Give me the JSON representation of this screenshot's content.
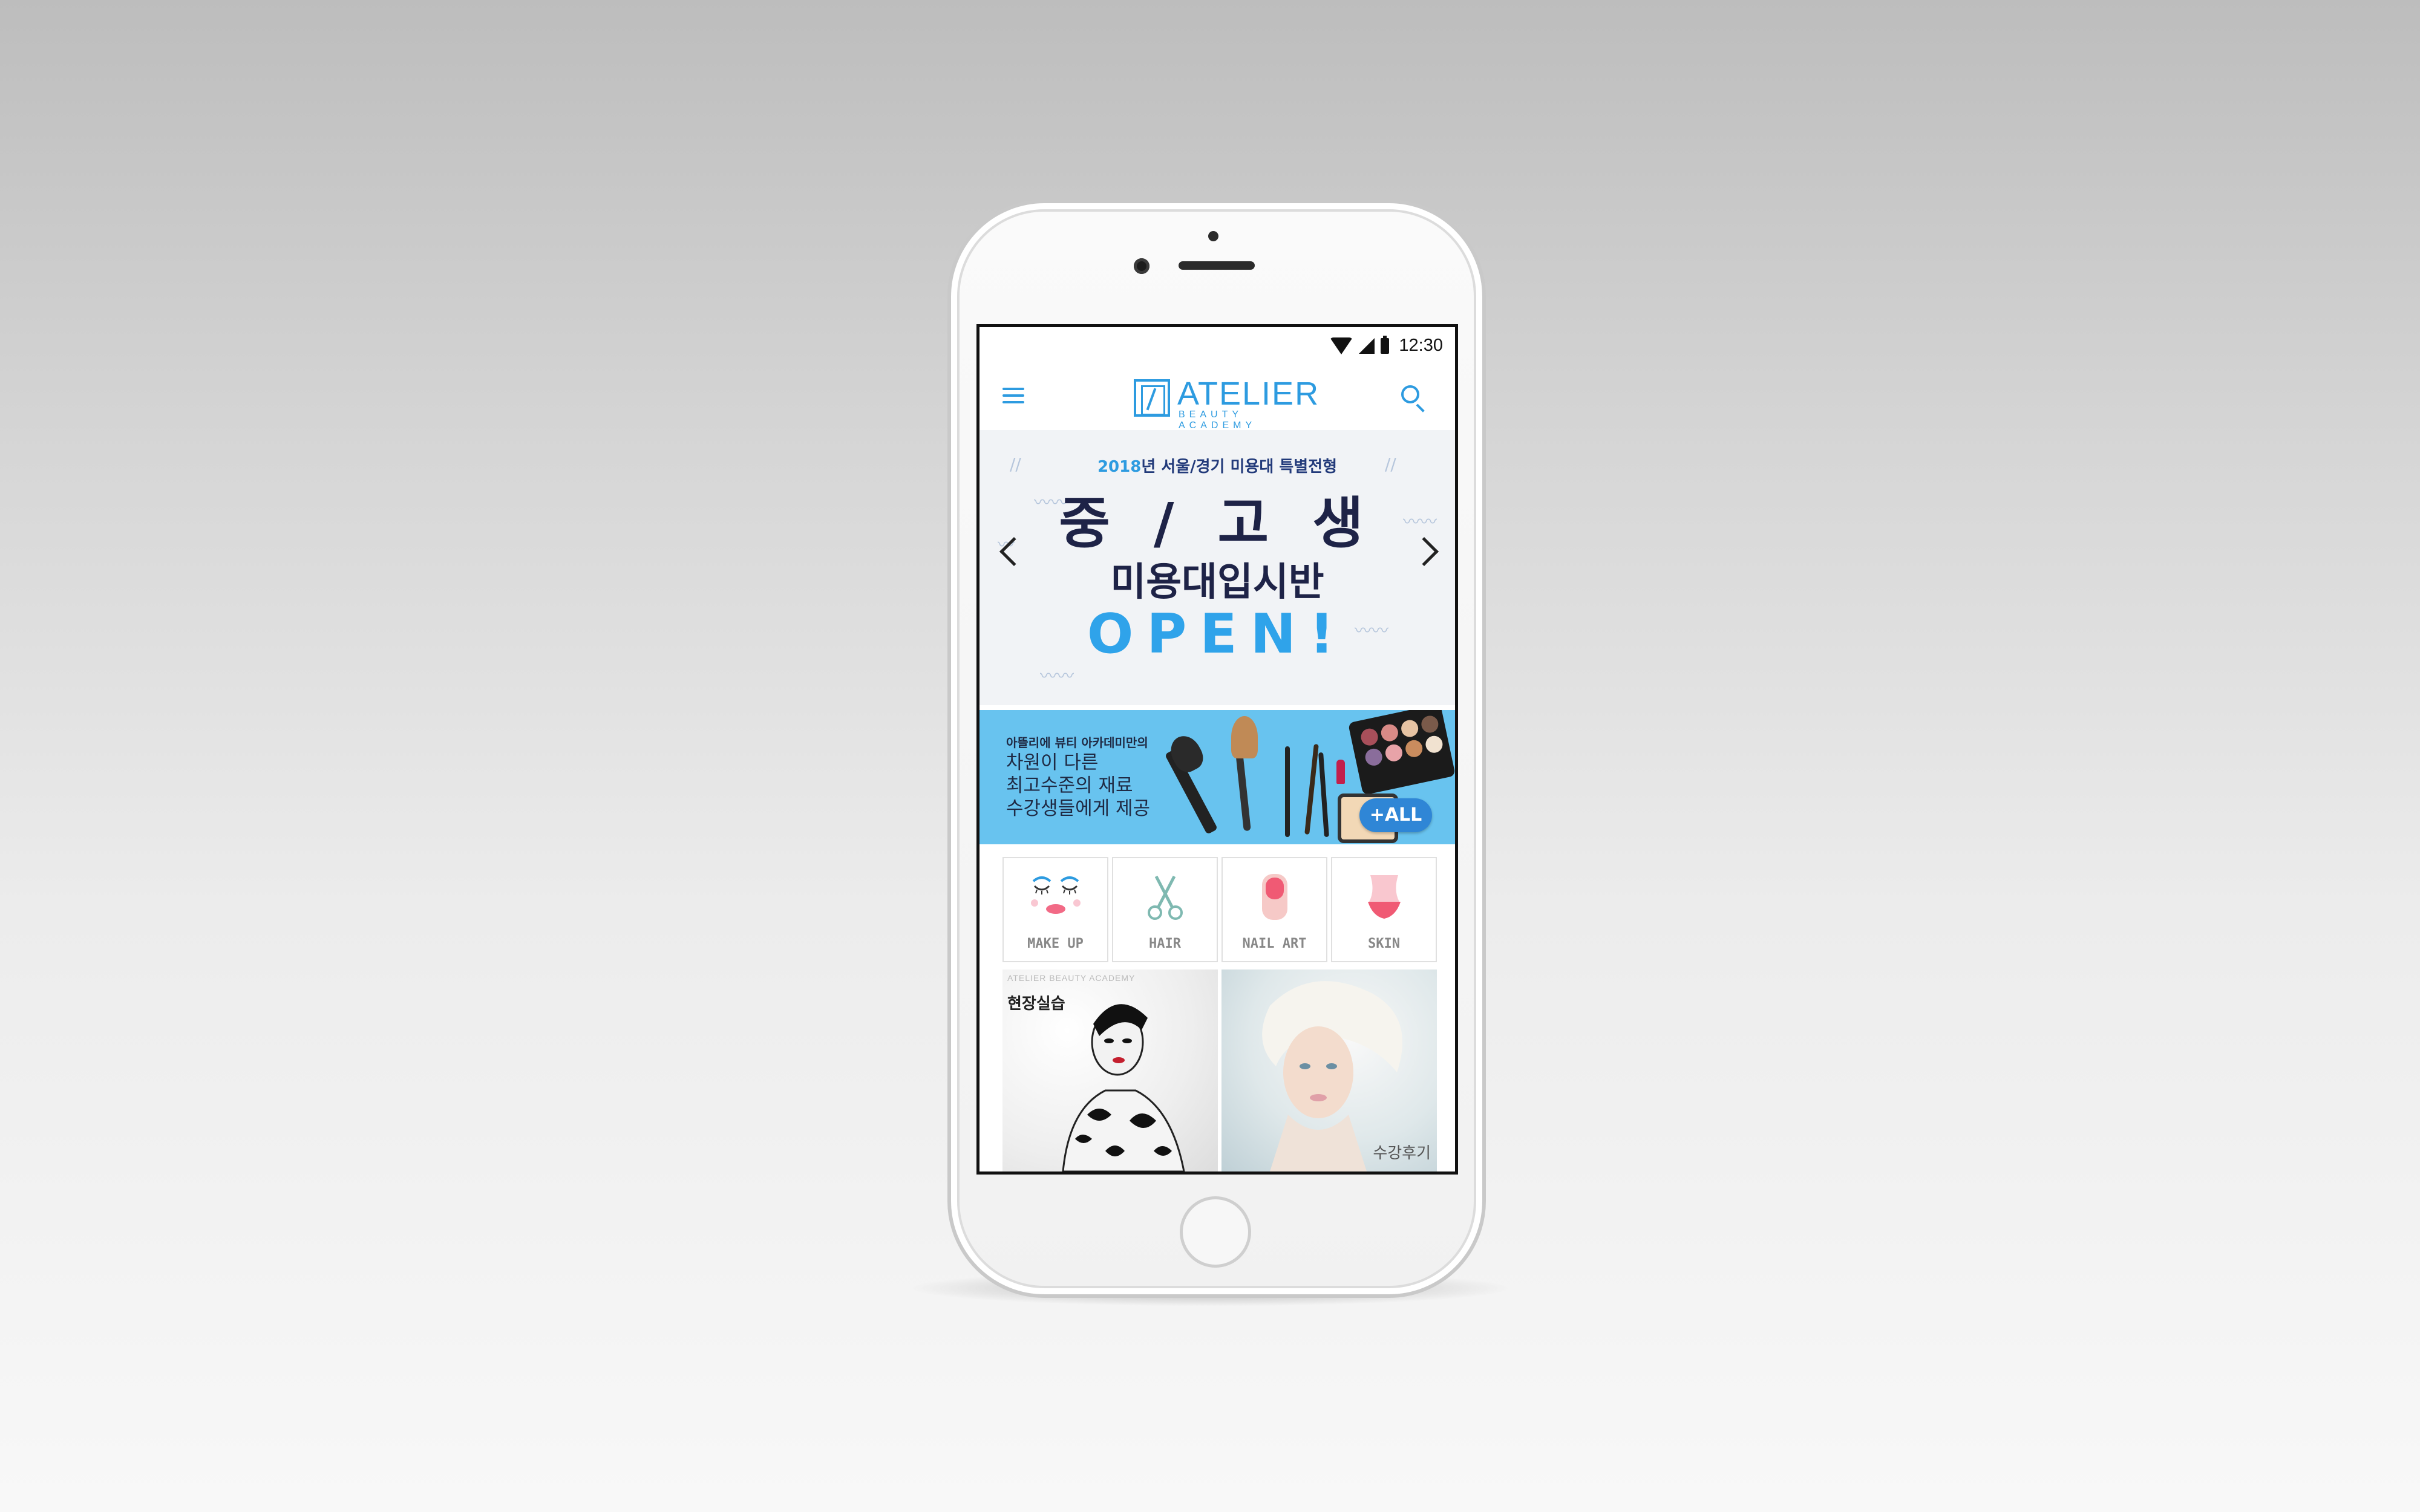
{
  "status_bar": {
    "time": "12:30"
  },
  "app_bar": {
    "logo_title": "ATELIER",
    "logo_subtitle": "BEAUTY ACADEMY"
  },
  "hero": {
    "year": "2018",
    "top_line_rest": "년 서울/경기 미용대 특별전형",
    "line1": "중 / 고 생",
    "line2": "미용대입시반",
    "line3": "OPEN!"
  },
  "promo": {
    "line1": "아뜰리에 뷰티 아카데미만의",
    "line2": "차원이 다른",
    "line3": "최고수준의 재료",
    "line4": "수강생들에게 제공",
    "all_button": "+ALL"
  },
  "categories": [
    {
      "label": "MAKE UP",
      "icon": "makeup-face-icon"
    },
    {
      "label": "HAIR",
      "icon": "scissors-icon"
    },
    {
      "label": "NAIL ART",
      "icon": "nail-icon"
    },
    {
      "label": "SKIN",
      "icon": "body-skin-icon"
    }
  ],
  "tiles": {
    "tile1_caption": "ATELIER BEAUTY ACADEMY",
    "tile1_label": "현장실습",
    "tile2_label": "수강후기"
  },
  "colors": {
    "accent": "#2d9be0",
    "hero_dark": "#1e2347",
    "promo_bg": "#68c3ef",
    "all_button": "#2f86d6"
  }
}
